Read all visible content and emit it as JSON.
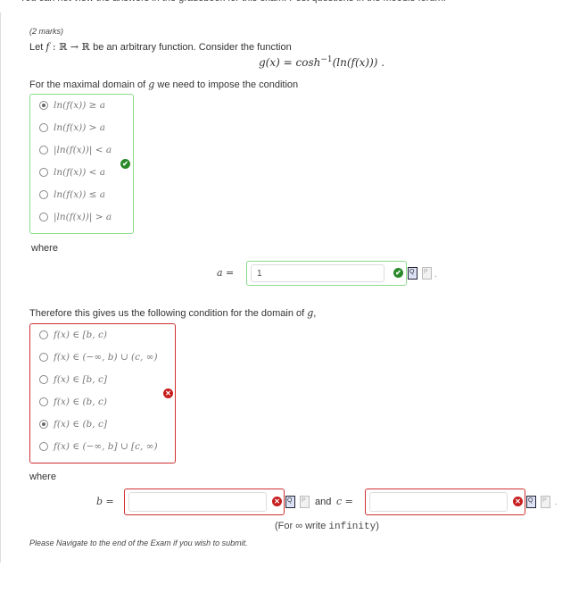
{
  "top_notice": "You can not view the answers in the gradebook for this exam. Post questions in the Moodle forum.",
  "question": {
    "marks": "(2 marks)",
    "intro_prefix": "Let ",
    "intro_f": "f",
    "intro_map": " : ℝ → ℝ ",
    "intro_suffix": "be an arbitrary function. Consider the function",
    "display_lhs": "g(x) = cosh",
    "display_sup": "−1",
    "display_rhs": "(ln(f(x))) .",
    "condition_prefix": "For the maximal domain of ",
    "condition_var": "g",
    "condition_suffix": " we need to impose the condition"
  },
  "part1": {
    "status": "correct",
    "options": [
      {
        "label": "ln(f(x)) ≥ a",
        "selected": true
      },
      {
        "label": "ln(f(x)) > a",
        "selected": false
      },
      {
        "label": "|ln(f(x))| < a",
        "selected": false
      },
      {
        "label": "ln(f(x)) < a",
        "selected": false
      },
      {
        "label": "ln(f(x)) ≤ a",
        "selected": false
      },
      {
        "label": "|ln(f(x))| > a",
        "selected": false
      }
    ],
    "where_label": "where",
    "a_label": "a =",
    "a_value": "1",
    "a_status": "correct"
  },
  "part2": {
    "intro_prefix": "Therefore this gives us the following condition for the domain of ",
    "intro_var": "g",
    "intro_suffix": ",",
    "status": "incorrect",
    "options": [
      {
        "label": "f(x) ∈ [b, c)",
        "selected": false
      },
      {
        "label": "f(x) ∈ (−∞, b) ∪ (c, ∞)",
        "selected": false
      },
      {
        "label": "f(x) ∈ [b, c]",
        "selected": false
      },
      {
        "label": "f(x) ∈ (b, c)",
        "selected": false
      },
      {
        "label": "f(x) ∈ (b, c]",
        "selected": true
      },
      {
        "label": "f(x) ∈ (−∞, b] ∪ [c, ∞)",
        "selected": false
      }
    ],
    "where_label": "where",
    "b_label": "b =",
    "b_value": "",
    "b_status": "incorrect",
    "and_label": "and",
    "c_label": "c =",
    "c_value": "",
    "c_status": "incorrect",
    "hint_prefix": "(For ∞ write ",
    "hint_code": "infinity",
    "hint_suffix": ")"
  },
  "icons": {
    "correct": "✔",
    "incorrect": "✕",
    "view_doc": "Q",
    "plain_doc": "P"
  },
  "footer_note": "Please Navigate to the end of the Exam if you wish to submit.",
  "colors": {
    "correct_border": "#8cdc8c",
    "correct_icon": "#2a8a2a",
    "incorrect_border": "#d03030",
    "incorrect_icon": "#c81e1e"
  }
}
